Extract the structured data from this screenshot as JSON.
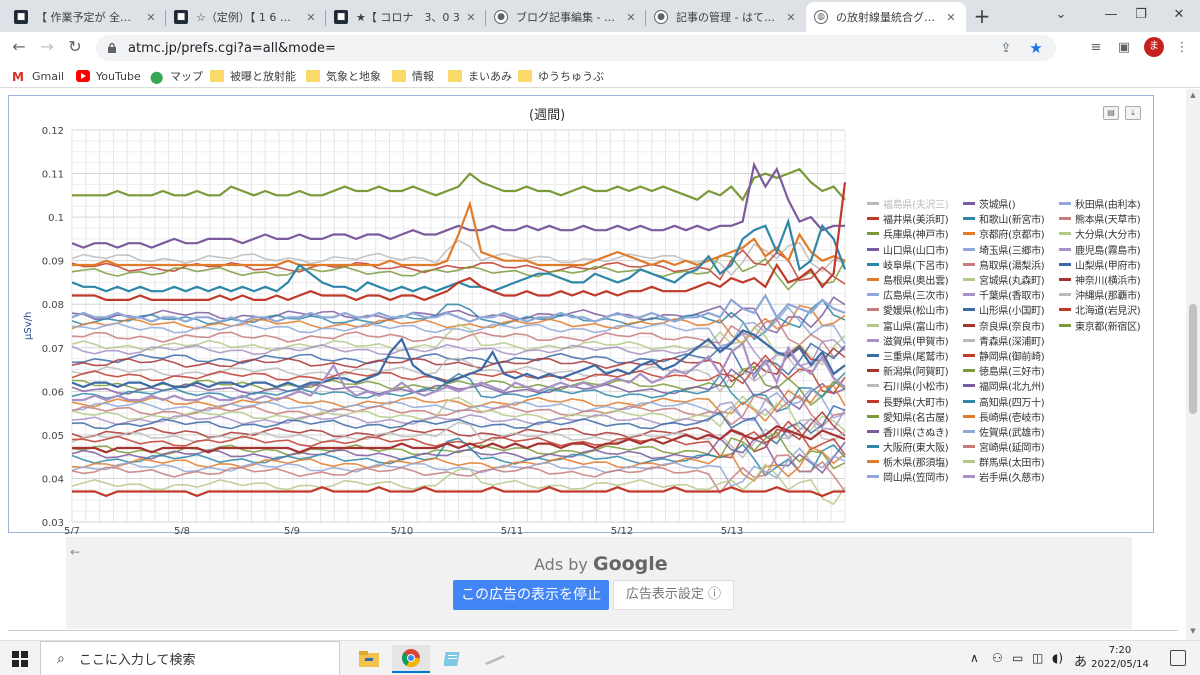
{
  "browser": {
    "tabs": [
      {
        "title": "【 作業予定が 全頓挫 】",
        "icon": "site-favicon"
      },
      {
        "title": "☆（定例）【 1 6 年 〕",
        "icon": "site-favicon"
      },
      {
        "title": "★【 コロナ　3、0 3",
        "icon": "site-favicon"
      },
      {
        "title": "ブログ記事編集 - はてな",
        "icon": "hatena-favicon"
      },
      {
        "title": "記事の管理 - はてなブロ",
        "icon": "hatena-favicon"
      },
      {
        "title": "の放射線量統合グラフ",
        "icon": "globe-icon",
        "active": true
      }
    ],
    "url": "atmc.jp/prefs.cgi?a=all&mode=",
    "profile_initial": "ま",
    "bookmarks": [
      {
        "label": "Gmail",
        "icon": "gmail-icon"
      },
      {
        "label": "YouTube",
        "icon": "youtube-icon"
      },
      {
        "label": "マップ",
        "icon": "maps-icon"
      },
      {
        "label": "被曝と放射能",
        "icon": "folder-icon"
      },
      {
        "label": "気象と地象",
        "icon": "folder-icon"
      },
      {
        "label": "情報",
        "icon": "folder-icon"
      },
      {
        "label": "まいあみ",
        "icon": "folder-icon"
      },
      {
        "label": "ゆうちゅうぶ",
        "icon": "folder-icon"
      }
    ]
  },
  "chart_data": {
    "type": "line",
    "title": "(週間)",
    "ylabel": "μSv/h",
    "xlabel": "",
    "ylim": [
      0.03,
      0.12
    ],
    "yticks": [
      "0.12",
      "0.11",
      "0.1",
      "0.09",
      "0.08",
      "0.07",
      "0.06",
      "0.05",
      "0.04",
      "0.03"
    ],
    "xticks": [
      "5/7",
      "5/8",
      "5/9",
      "5/10",
      "5/11",
      "5/12",
      "5/13"
    ],
    "grid": true,
    "legend_position": "right",
    "legend_columns": [
      [
        "福島県(夫沢三)",
        "福井県(美浜町)",
        "兵庫県(神戸市)",
        "山口県(山口市)",
        "岐阜県(下呂市)",
        "島根県(奥出雲)",
        "広島県(三次市)",
        "愛媛県(松山市)",
        "富山県(富山市)",
        "滋賀県(甲賀市)",
        "三重県(尾鷲市)",
        "新潟県(阿賀町)",
        "石川県(小松市)",
        "長野県(大町市)",
        "愛知県(名古屋)",
        "香川県(さぬき)",
        "大阪府(東大阪)",
        "栃木県(那須塩)",
        "岡山県(笠岡市)"
      ],
      [
        "茨城県()",
        "和歌山(新宮市)",
        "京都府(京都市)",
        "埼玉県(三郷市)",
        "鳥取県(湯梨浜)",
        "宮城県(丸森町)",
        "千葉県(香取市)",
        "山形県(小国町)",
        "奈良県(奈良市)",
        "青森県(深浦町)",
        "静岡県(御前崎)",
        "徳島県(三好市)",
        "福岡県(北九州)",
        "高知県(四万十)",
        "長崎県(壱岐市)",
        "佐賀県(武雄市)",
        "宮崎県(延岡市)",
        "群馬県(太田市)",
        "岩手県(久慈市)"
      ],
      [
        "秋田県(由利本)",
        "熊本県(天草市)",
        "大分県(大分市)",
        "鹿児島(霧島市)",
        "山梨県(甲府市)",
        "神奈川(横浜市)",
        "沖縄県(那覇市)",
        "北海道(岩見沢)",
        "東京都(新宿区)"
      ]
    ],
    "series_colors": [
      "#bbbbbb",
      "#c0392b",
      "#7a9a3a",
      "#7c5a9e",
      "#2e86a8",
      "#e07b2a",
      "#8fa8d8",
      "#c77b7b",
      "#b5c98a",
      "#a891c4",
      "#3b6aa6",
      "#a83232"
    ],
    "series": [
      {
        "name": "秋田県(由利本)",
        "color": "#7a9a3a",
        "values": [
          0.105,
          0.105,
          0.105,
          0.105,
          0.106,
          0.105,
          0.105,
          0.105,
          0.106,
          0.105,
          0.105,
          0.106,
          0.105,
          0.105,
          0.107,
          0.106,
          0.105,
          0.106,
          0.105,
          0.105,
          0.106,
          0.105,
          0.105,
          0.106,
          0.107,
          0.106,
          0.106,
          0.107,
          0.106,
          0.106,
          0.107,
          0.106,
          0.105,
          0.106,
          0.107,
          0.11,
          0.108,
          0.107,
          0.106,
          0.106,
          0.107,
          0.106,
          0.106,
          0.105,
          0.106,
          0.107,
          0.106,
          0.106,
          0.107,
          0.106,
          0.107,
          0.106,
          0.107,
          0.106,
          0.105,
          0.104,
          0.106,
          0.105,
          0.107,
          0.104,
          0.109,
          0.11,
          0.109,
          0.11,
          0.111,
          0.108,
          0.106,
          0.107,
          0.104
        ]
      },
      {
        "name": "熊本県(天草市)",
        "color": "#7c5a9e",
        "values": [
          0.094,
          0.093,
          0.094,
          0.094,
          0.093,
          0.094,
          0.094,
          0.093,
          0.094,
          0.095,
          0.094,
          0.094,
          0.095,
          0.095,
          0.095,
          0.094,
          0.095,
          0.096,
          0.095,
          0.095,
          0.096,
          0.095,
          0.095,
          0.096,
          0.096,
          0.095,
          0.096,
          0.096,
          0.095,
          0.096,
          0.097,
          0.096,
          0.096,
          0.097,
          0.098,
          0.097,
          0.097,
          0.098,
          0.097,
          0.097,
          0.098,
          0.097,
          0.098,
          0.097,
          0.097,
          0.098,
          0.097,
          0.097,
          0.098,
          0.097,
          0.098,
          0.097,
          0.097,
          0.098,
          0.097,
          0.098,
          0.097,
          0.098,
          0.098,
          0.099,
          0.112,
          0.107,
          0.111,
          0.104,
          0.099,
          0.1,
          0.097,
          0.098,
          0.098
        ]
      },
      {
        "name": "鳥取県(湯梨浜)",
        "color": "#e07b2a",
        "values": [
          0.089,
          0.089,
          0.089,
          0.09,
          0.089,
          0.089,
          0.089,
          0.089,
          0.089,
          0.089,
          0.089,
          0.089,
          0.089,
          0.089,
          0.089,
          0.089,
          0.089,
          0.089,
          0.089,
          0.09,
          0.089,
          0.089,
          0.089,
          0.089,
          0.089,
          0.089,
          0.089,
          0.089,
          0.09,
          0.089,
          0.089,
          0.089,
          0.089,
          0.09,
          0.096,
          0.103,
          0.092,
          0.091,
          0.09,
          0.09,
          0.09,
          0.089,
          0.089,
          0.089,
          0.089,
          0.089,
          0.09,
          0.091,
          0.092,
          0.091,
          0.09,
          0.089,
          0.09,
          0.089,
          0.09,
          0.089,
          0.09,
          0.091,
          0.092,
          0.093,
          0.095,
          0.091,
          0.093,
          0.09,
          0.096,
          0.092,
          0.09,
          0.091,
          0.09
        ]
      },
      {
        "name": "大分県(大分市)",
        "color": "#2e86a8",
        "values": [
          0.085,
          0.084,
          0.084,
          0.083,
          0.084,
          0.083,
          0.084,
          0.083,
          0.083,
          0.084,
          0.083,
          0.084,
          0.083,
          0.084,
          0.083,
          0.084,
          0.083,
          0.084,
          0.083,
          0.085,
          0.089,
          0.087,
          0.085,
          0.084,
          0.084,
          0.083,
          0.085,
          0.084,
          0.083,
          0.084,
          0.083,
          0.084,
          0.083,
          0.084,
          0.085,
          0.084,
          0.084,
          0.083,
          0.084,
          0.085,
          0.086,
          0.087,
          0.087,
          0.086,
          0.085,
          0.085,
          0.087,
          0.086,
          0.085,
          0.086,
          0.088,
          0.087,
          0.086,
          0.085,
          0.087,
          0.088,
          0.091,
          0.087,
          0.089,
          0.095,
          0.097,
          0.098,
          0.092,
          0.099,
          0.088,
          0.09,
          0.098,
          0.095,
          0.088
        ]
      },
      {
        "name": "茨城県()",
        "color": "#c0392b",
        "values": [
          0.082,
          0.082,
          0.082,
          0.081,
          0.081,
          0.081,
          0.082,
          0.081,
          0.081,
          0.081,
          0.081,
          0.081,
          0.081,
          0.082,
          0.081,
          0.082,
          0.081,
          0.081,
          0.082,
          0.081,
          0.082,
          0.083,
          0.082,
          0.082,
          0.082,
          0.081,
          0.082,
          0.082,
          0.081,
          0.082,
          0.082,
          0.081,
          0.082,
          0.083,
          0.085,
          0.086,
          0.084,
          0.083,
          0.082,
          0.082,
          0.083,
          0.082,
          0.082,
          0.083,
          0.082,
          0.083,
          0.082,
          0.083,
          0.082,
          0.083,
          0.083,
          0.084,
          0.083,
          0.083,
          0.083,
          0.084,
          0.085,
          0.084,
          0.086,
          0.085,
          0.086,
          0.084,
          0.089,
          0.085,
          0.086,
          0.088,
          0.084,
          0.087,
          0.108
        ]
      },
      {
        "name": "山梨県(甲府市)",
        "color": "#8fa8d8",
        "values": [
          0.077,
          0.078,
          0.077,
          0.077,
          0.078,
          0.077,
          0.077,
          0.076,
          0.077,
          0.077,
          0.076,
          0.077,
          0.077,
          0.076,
          0.077,
          0.076,
          0.077,
          0.077,
          0.076,
          0.077,
          0.077,
          0.078,
          0.077,
          0.077,
          0.078,
          0.077,
          0.077,
          0.078,
          0.077,
          0.077,
          0.078,
          0.077,
          0.077,
          0.078,
          0.077,
          0.076,
          0.077,
          0.077,
          0.078,
          0.077,
          0.076,
          0.077,
          0.077,
          0.078,
          0.077,
          0.077,
          0.076,
          0.077,
          0.078,
          0.077,
          0.077,
          0.078,
          0.077,
          0.076,
          0.077,
          0.077,
          0.078,
          0.077,
          0.081,
          0.079,
          0.078,
          0.082,
          0.077,
          0.08,
          0.079,
          0.078,
          0.081,
          0.079,
          0.078
        ]
      },
      {
        "name": "北海道(岩見沢)",
        "color": "#3b6aa6",
        "values": [
          0.062,
          0.061,
          0.062,
          0.062,
          0.061,
          0.062,
          0.062,
          0.061,
          0.062,
          0.061,
          0.061,
          0.062,
          0.061,
          0.062,
          0.062,
          0.061,
          0.062,
          0.062,
          0.061,
          0.062,
          0.061,
          0.062,
          0.062,
          0.063,
          0.063,
          0.062,
          0.063,
          0.064,
          0.069,
          0.072,
          0.066,
          0.064,
          0.063,
          0.062,
          0.063,
          0.064,
          0.065,
          0.069,
          0.064,
          0.063,
          0.064,
          0.063,
          0.064,
          0.063,
          0.064,
          0.065,
          0.066,
          0.064,
          0.065,
          0.064,
          0.066,
          0.067,
          0.065,
          0.066,
          0.068,
          0.07,
          0.072,
          0.069,
          0.071,
          0.074,
          0.073,
          0.071,
          0.069,
          0.068,
          0.07,
          0.066,
          0.069,
          0.064,
          0.066
        ]
      },
      {
        "name": "神奈川(横浜市)",
        "color": "#a891c4",
        "values": [
          0.058,
          0.058,
          0.059,
          0.058,
          0.059,
          0.058,
          0.058,
          0.059,
          0.058,
          0.059,
          0.058,
          0.058,
          0.059,
          0.058,
          0.058,
          0.059,
          0.058,
          0.059,
          0.058,
          0.059,
          0.06,
          0.059,
          0.062,
          0.066,
          0.061,
          0.059,
          0.06,
          0.059,
          0.06,
          0.062,
          0.06,
          0.059,
          0.06,
          0.061,
          0.06,
          0.061,
          0.062,
          0.061,
          0.06,
          0.062,
          0.061,
          0.06,
          0.061,
          0.062,
          0.061,
          0.062,
          0.061,
          0.062,
          0.063,
          0.062,
          0.064,
          0.062,
          0.063,
          0.065,
          0.064,
          0.066,
          0.068,
          0.064,
          0.069,
          0.071,
          0.063,
          0.067,
          0.062,
          0.07,
          0.066,
          0.064,
          0.068,
          0.063,
          0.061
        ]
      },
      {
        "name": "東京都(新宿区)",
        "color": "#a83232",
        "values": [
          0.047,
          0.047,
          0.047,
          0.046,
          0.047,
          0.047,
          0.047,
          0.046,
          0.047,
          0.047,
          0.047,
          0.047,
          0.046,
          0.047,
          0.047,
          0.047,
          0.047,
          0.047,
          0.047,
          0.047,
          0.046,
          0.047,
          0.047,
          0.047,
          0.047,
          0.047,
          0.047,
          0.047,
          0.047,
          0.048,
          0.047,
          0.047,
          0.047,
          0.048,
          0.047,
          0.048,
          0.047,
          0.048,
          0.047,
          0.048,
          0.047,
          0.048,
          0.048,
          0.047,
          0.048,
          0.048,
          0.047,
          0.048,
          0.048,
          0.049,
          0.048,
          0.049,
          0.048,
          0.049,
          0.05,
          0.049,
          0.05,
          0.049,
          0.051,
          0.05,
          0.049,
          0.05,
          0.052,
          0.051,
          0.05,
          0.049,
          0.051,
          0.05,
          0.049
        ]
      },
      {
        "name": "岩手県(久慈市)",
        "color": "#c0392b",
        "values": [
          0.037,
          0.037,
          0.037,
          0.036,
          0.037,
          0.037,
          0.037,
          0.037,
          0.037,
          0.037,
          0.037,
          0.036,
          0.037,
          0.037,
          0.037,
          0.037,
          0.037,
          0.037,
          0.037,
          0.037,
          0.037,
          0.037,
          0.038,
          0.037,
          0.037,
          0.037,
          0.037,
          0.038,
          0.037,
          0.037,
          0.037,
          0.038,
          0.037,
          0.037,
          0.037,
          0.037,
          0.037,
          0.038,
          0.037,
          0.037,
          0.037,
          0.037,
          0.038,
          0.037,
          0.037,
          0.037,
          0.037,
          0.037,
          0.038,
          0.037,
          0.037,
          0.037,
          0.037,
          0.038,
          0.037,
          0.037,
          0.037,
          0.037,
          0.038,
          0.037,
          0.037,
          0.037,
          0.038,
          0.037,
          0.037,
          0.037,
          0.036,
          0.037,
          0.037
        ]
      }
    ]
  },
  "page": {
    "left_arrow": "←",
    "ads_by": "Ads by",
    "ads_brand": "Google",
    "ad_stop_label": "この広告の表示を停止",
    "ad_settings_label": "広告表示設定 ⓘ"
  },
  "taskbar": {
    "search_placeholder": "ここに入力して検索",
    "ime": "あ",
    "time": "7:20",
    "date": "2022/05/14"
  }
}
